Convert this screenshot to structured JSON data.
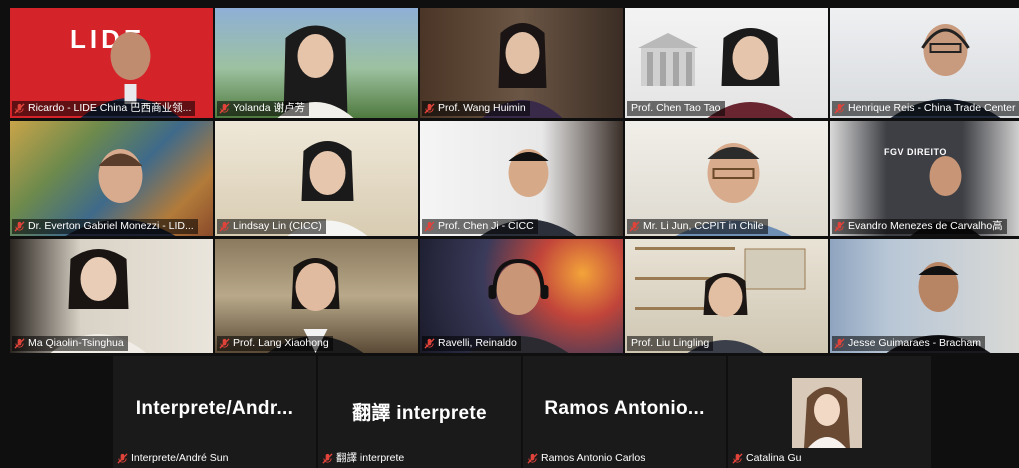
{
  "colors": {
    "active_border": "#f0d23a",
    "mic_muted": "#e0433a",
    "tile_bg": "#1d1d1d",
    "name_text": "#ffffff"
  },
  "logos": {
    "lide_brand": "LIDE",
    "fgv_brand": "FGV DIREITO"
  },
  "participants": [
    {
      "name": "Ricardo - LIDE China 巴西商业领...",
      "muted": true,
      "active": true
    },
    {
      "name": "Yolanda 谢卢芳",
      "muted": true
    },
    {
      "name": "Prof. Wang Huimin",
      "muted": true
    },
    {
      "name": "Prof. Chen Tao Tao",
      "muted": false
    },
    {
      "name": "Henrique Reis - China Trade Center",
      "muted": true
    },
    {
      "name": "Dr. Everton Gabriel Monezzi - LID...",
      "muted": true
    },
    {
      "name": "Lindsay Lin (CICC)",
      "muted": true
    },
    {
      "name": "Prof. Chen Ji - CICC",
      "muted": true
    },
    {
      "name": "Mr. Li Jun, CCPIT in Chile",
      "muted": true
    },
    {
      "name": "Evandro Menezes de Carvalho高",
      "muted": true
    },
    {
      "name": "Ma Qiaolin-Tsinghua",
      "muted": true
    },
    {
      "name": "Prof. Lang Xiaohong",
      "muted": true
    },
    {
      "name": "Ravelli, Reinaldo",
      "muted": true
    },
    {
      "name": "Prof. Liu Lingling",
      "muted": false
    },
    {
      "name": "Jesse Guimaraes - Bracham",
      "muted": true
    },
    {
      "name": "Interprete/André Sun",
      "muted": true,
      "display": "Interprete/Andr..."
    },
    {
      "name": "翻譯 interprete",
      "muted": true,
      "display": "翻譯 interprete"
    },
    {
      "name": "Ramos Antonio Carlos",
      "muted": true,
      "display": "Ramos Antonio..."
    },
    {
      "name": "Catalina Gu",
      "muted": true
    }
  ]
}
